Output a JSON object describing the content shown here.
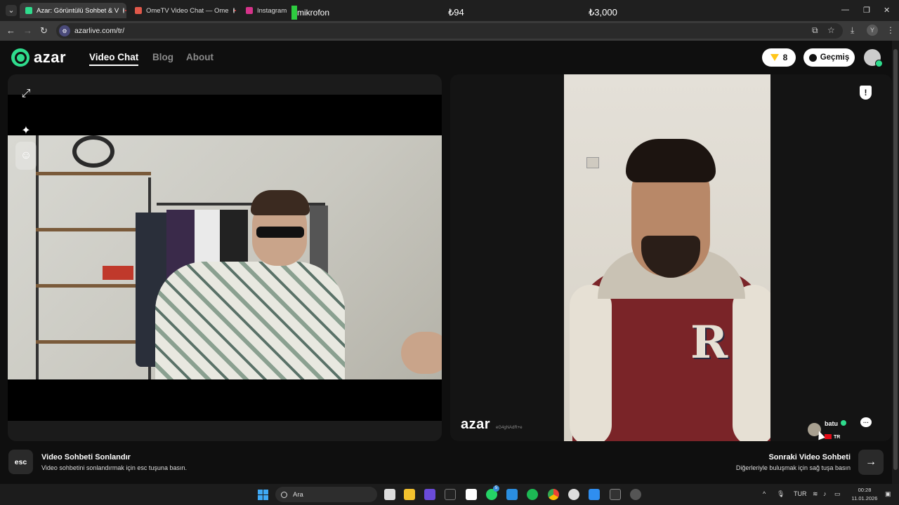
{
  "browser": {
    "tabs": [
      {
        "title": "Azar: Görüntülü Sohbet & V",
        "active": true,
        "favicon_color": "#2fdc8d"
      },
      {
        "title": "OmeTV Video Chat — Ome",
        "active": false,
        "favicon_color": "#e0584a"
      },
      {
        "title": "Instagram",
        "active": false,
        "favicon_color": "#d6338a"
      }
    ],
    "close_glyph": "✕",
    "overlay_mic": "mikrofon",
    "overlay_amount_1": "₺94",
    "overlay_amount_2": "₺3,000",
    "url": "azarlive.com/tr/",
    "profile_letter": "Y"
  },
  "app": {
    "logo": "azar",
    "nav": [
      {
        "label": "Video Chat",
        "active": true
      },
      {
        "label": "Blog",
        "active": false
      },
      {
        "label": "About",
        "active": false
      }
    ],
    "gems": "8",
    "history_label": "Geçmiş"
  },
  "remote": {
    "watermark_logo": "azar",
    "watermark_id": "eG4gNAdR+e",
    "partner_name": "batu",
    "partner_country": "TR",
    "jacket_letter": "R"
  },
  "footer": {
    "esc_key": "esc",
    "end_title": "Video Sohbeti Sonlandır",
    "end_sub": "Video sohbetini sonlandırmak için esc tuşuna basın.",
    "next_title": "Sonraki Video Sohbeti",
    "next_sub": "Diğerleriyle buluşmak için sağ tuşa basın",
    "next_arrow": "→"
  },
  "taskbar": {
    "search_placeholder": "Ara",
    "language": "TUR",
    "time": "00:28",
    "date": "11.01.2026",
    "whatsapp_badge": "5"
  },
  "colors": {
    "accent_green": "#2fdc8d",
    "gem_yellow": "#ffc61a",
    "jacket_maroon": "#7a2428"
  }
}
